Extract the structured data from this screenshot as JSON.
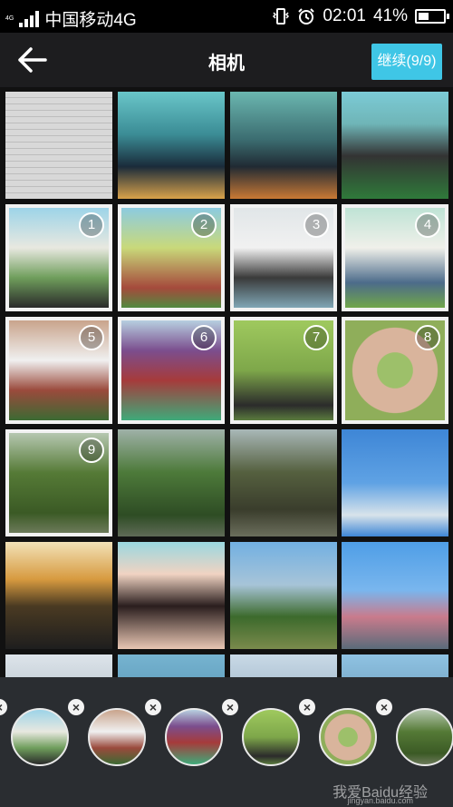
{
  "status_bar": {
    "network_tag": "4G",
    "carrier": "中国移动4G",
    "time": "02:01",
    "battery": "41%",
    "battery_level": 0.41,
    "icons": [
      "signal-icon",
      "vibrate-icon",
      "alarm-icon",
      "battery-icon"
    ]
  },
  "header": {
    "title": "相机",
    "continue_label": "继续(9/9)",
    "accent": "#3fc6e6"
  },
  "grid": {
    "badges": [
      "1",
      "2",
      "3",
      "4",
      "5",
      "6",
      "7",
      "8",
      "9"
    ]
  },
  "tray": {
    "watermark": "我爱Baidu经验",
    "watermark_url": "jingyan.baidu.com"
  }
}
